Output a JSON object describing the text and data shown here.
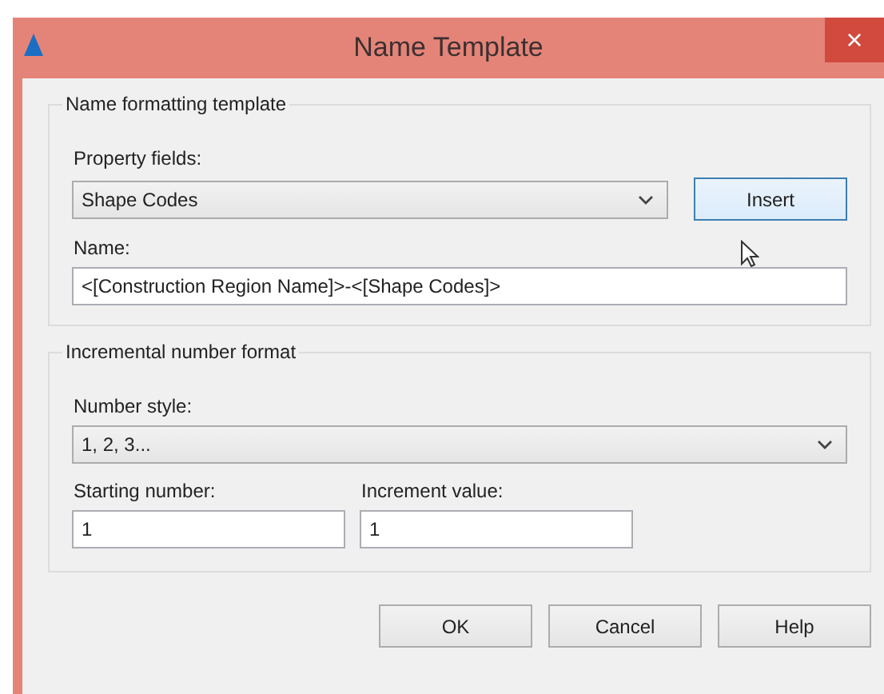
{
  "window": {
    "title": "Name Template",
    "close": "×"
  },
  "name_group": {
    "legend": "Name formatting template",
    "property_label": "Property fields:",
    "property_value": "Shape Codes",
    "insert_button": {
      "label": "Insert",
      "focused": true
    },
    "name_label": "Name:",
    "name_value": "<[Construction Region Name]>-<[Shape Codes]>"
  },
  "number_group": {
    "legend": "Incremental number format",
    "style_label": "Number style:",
    "style_value": "1, 2, 3...",
    "start_label": "Starting number:",
    "start_value": "1",
    "increment_label": "Increment value:",
    "increment_value": "1"
  },
  "buttons": [
    "OK",
    "Cancel",
    "Help"
  ]
}
